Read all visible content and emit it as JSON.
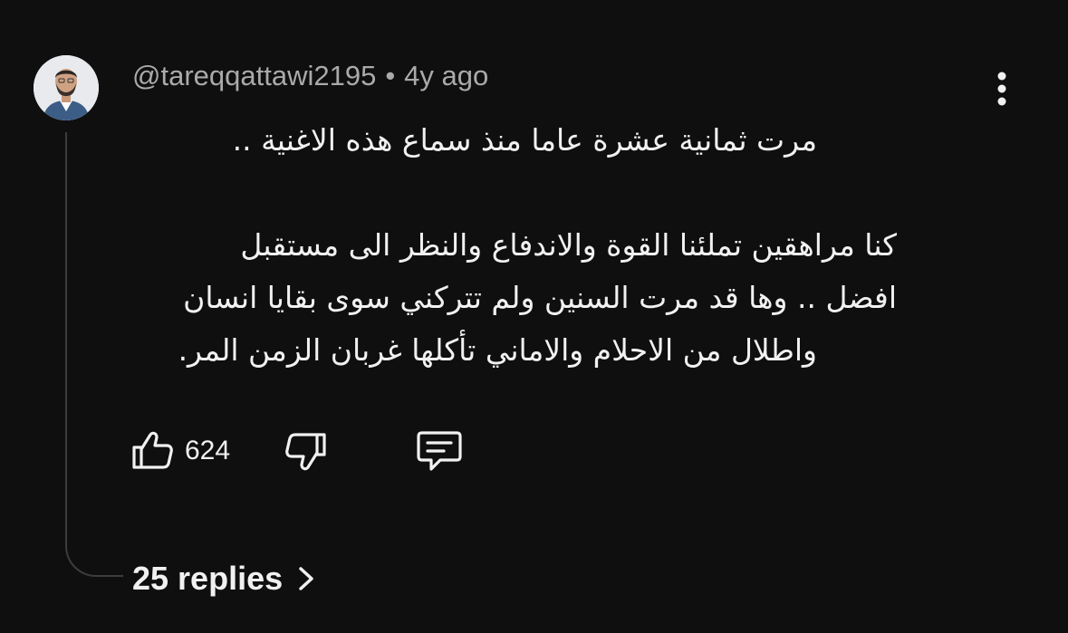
{
  "comment": {
    "author": "@tareqqattawi2195",
    "separator": "•",
    "time": "4y ago",
    "lines": [
      "مرت ثمانية عشرة عاما منذ سماع هذه الاغنية ..",
      "كنا مراهقين تملئنا القوة والاندفاع والنظر الى مستقبل",
      "افضل .. وها قد مرت السنين ولم تتركني سوى بقايا انسان",
      "واطلال من الاحلام والاماني تأكلها غربان الزمن المر."
    ],
    "likes": "624",
    "replies_label": "25 replies"
  },
  "icons": {
    "avatar": "avatar-photo",
    "more": "more-vertical-icon",
    "like": "thumbs-up-icon",
    "dislike": "thumbs-down-icon",
    "reply": "comment-icon",
    "expand": "chevron-right-icon"
  },
  "colors": {
    "background": "#0f0f0f",
    "text": "#f1f1f1",
    "secondary_text": "#aaaaaa",
    "thread_line": "#3d3d3d"
  }
}
